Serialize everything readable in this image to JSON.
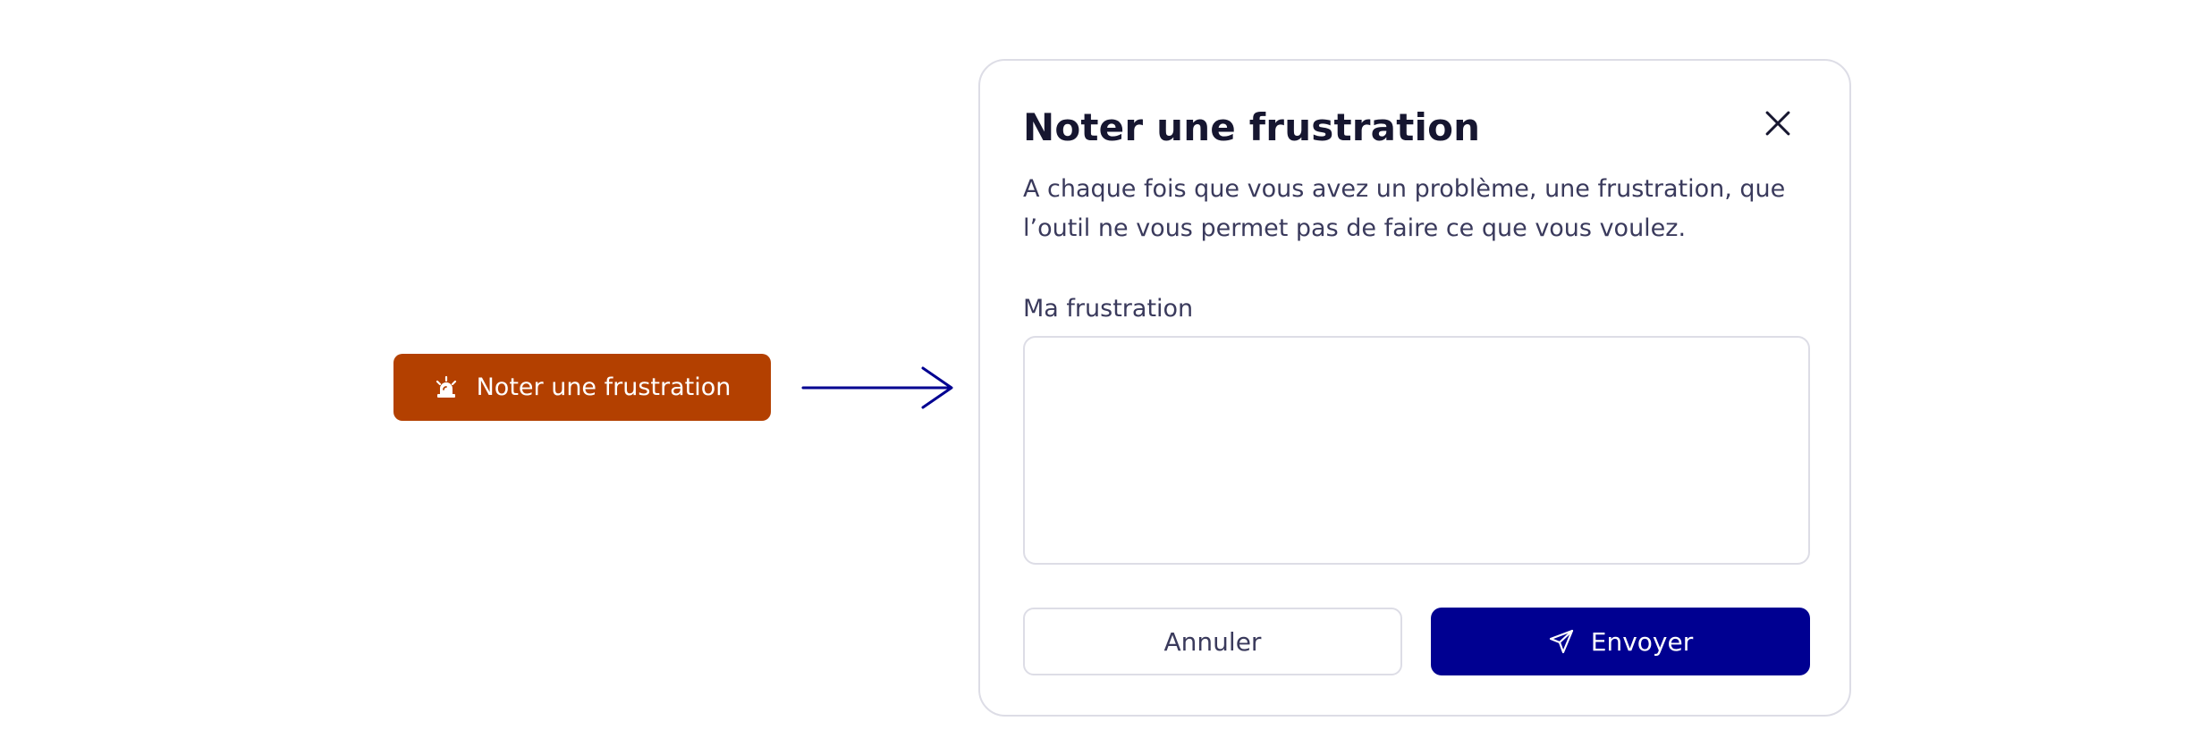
{
  "trigger": {
    "label": "Noter une frustration",
    "icon": "alarm-siren-icon",
    "color": "#b34000"
  },
  "dialog": {
    "title": "Noter une frustration",
    "description": "A chaque fois que vous avez un problème, une frustration, que l’outil ne vous permet pas de faire ce que vous voulez.",
    "field": {
      "label": "Ma frustration",
      "value": "",
      "placeholder": ""
    },
    "close_icon": "close-icon",
    "buttons": {
      "cancel_label": "Annuler",
      "send_label": "Envoyer",
      "send_icon": "send-icon",
      "send_color": "#000091"
    }
  },
  "colors": {
    "accent_blue": "#000091",
    "warning_orange": "#b34000",
    "border": "#dddde6"
  }
}
